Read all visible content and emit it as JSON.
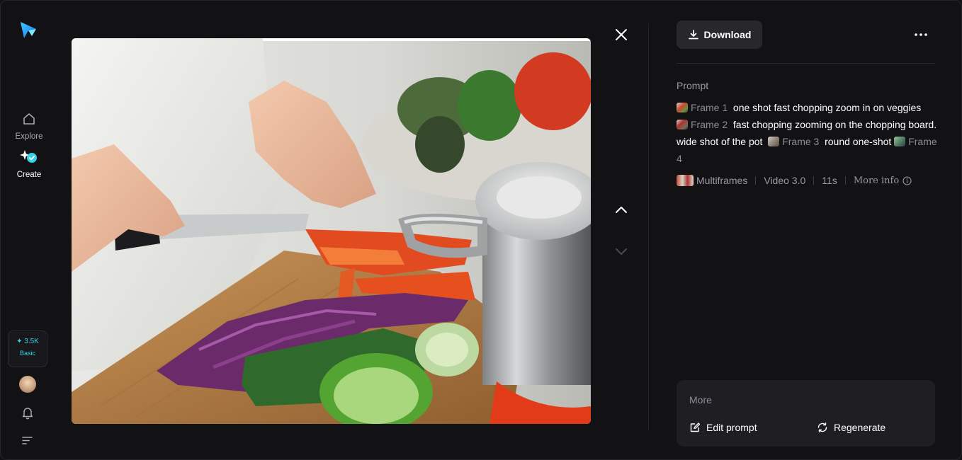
{
  "sidebar": {
    "items": [
      {
        "label": "Explore",
        "icon": "home-icon"
      },
      {
        "label": "Create",
        "icon": "create-icon"
      }
    ],
    "credits": {
      "amount": "✦ 3.5K",
      "tier": "Basic"
    }
  },
  "toolbar": {
    "download_label": "Download"
  },
  "prompt": {
    "label": "Prompt",
    "segments": [
      {
        "frame": "Frame 1",
        "text": "one shot fast chopping zoom in on veggies"
      },
      {
        "frame": "Frame 2",
        "text": "fast chopping zooming on the chopping board. wide shot of the pot"
      },
      {
        "frame": "Frame 3",
        "text": "round one-shot"
      },
      {
        "frame": "Frame 4",
        "text": ""
      }
    ]
  },
  "meta": {
    "mode": "Multiframes",
    "model": "Video 3.0",
    "duration": "11s",
    "more_info": "More info"
  },
  "more": {
    "title": "More",
    "edit_prompt": "Edit prompt",
    "regenerate": "Regenerate"
  },
  "colors": {
    "accent": "#35d3e6",
    "background": "#121215",
    "card": "#1e1e23"
  }
}
